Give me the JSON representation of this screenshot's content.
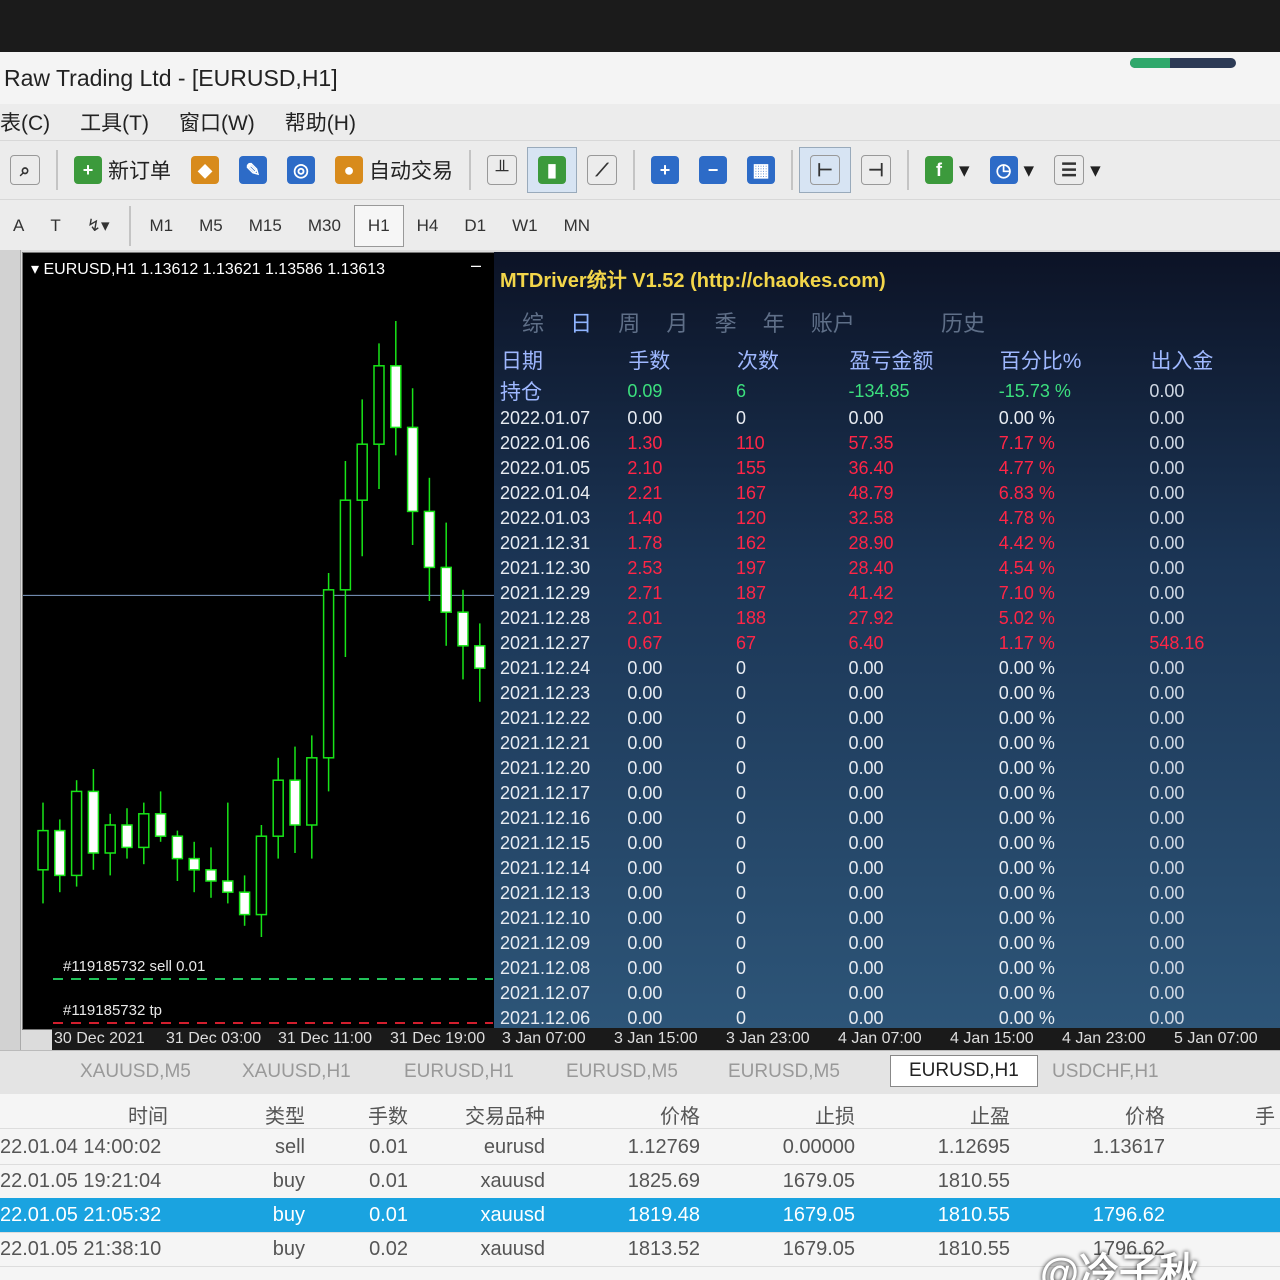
{
  "window": {
    "title": "Raw Trading Ltd - [EURUSD,H1]"
  },
  "menu": [
    "表(C)",
    "工具(T)",
    "窗口(W)",
    "帮助(H)"
  ],
  "toolbar": {
    "new_order": "新订单",
    "auto_trading": "自动交易"
  },
  "timeframes": [
    "M1",
    "M5",
    "M15",
    "M30",
    "H1",
    "H4",
    "D1",
    "W1",
    "MN"
  ],
  "timeframe_active": "H1",
  "drawtools": {
    "text": "A",
    "label": "T"
  },
  "chart": {
    "symbol_line": "EURUSD,H1  1.13612 1.13621 1.13586 1.13613",
    "order_sell": "#119185732 sell 0.01",
    "order_tp": "#119185732 tp",
    "colors": {
      "bull": "#18e418",
      "bg": "#000000"
    },
    "candles": [
      [
        1.1322,
        1.1334,
        1.1316,
        1.1329
      ],
      [
        1.1329,
        1.1331,
        1.1318,
        1.1321
      ],
      [
        1.1321,
        1.1338,
        1.1319,
        1.1336
      ],
      [
        1.1336,
        1.134,
        1.1322,
        1.1325
      ],
      [
        1.1325,
        1.1332,
        1.1321,
        1.133
      ],
      [
        1.133,
        1.1333,
        1.1324,
        1.1326
      ],
      [
        1.1326,
        1.1334,
        1.1323,
        1.1332
      ],
      [
        1.1332,
        1.1336,
        1.1327,
        1.1328
      ],
      [
        1.1328,
        1.1329,
        1.132,
        1.1324
      ],
      [
        1.1324,
        1.1327,
        1.1318,
        1.1322
      ],
      [
        1.1322,
        1.1326,
        1.1317,
        1.132
      ],
      [
        1.132,
        1.1334,
        1.1316,
        1.1318
      ],
      [
        1.1318,
        1.1321,
        1.1312,
        1.1314
      ],
      [
        1.1314,
        1.133,
        1.131,
        1.1328
      ],
      [
        1.1328,
        1.1342,
        1.1324,
        1.1338
      ],
      [
        1.1338,
        1.1344,
        1.1325,
        1.133
      ],
      [
        1.133,
        1.1346,
        1.1324,
        1.1342
      ],
      [
        1.1342,
        1.1375,
        1.1336,
        1.1372
      ],
      [
        1.1372,
        1.1395,
        1.136,
        1.1388
      ],
      [
        1.1388,
        1.1406,
        1.1378,
        1.1398
      ],
      [
        1.1398,
        1.1416,
        1.139,
        1.1412
      ],
      [
        1.1412,
        1.142,
        1.1396,
        1.1401
      ],
      [
        1.1401,
        1.1408,
        1.138,
        1.1386
      ],
      [
        1.1386,
        1.1392,
        1.137,
        1.1376
      ],
      [
        1.1376,
        1.1384,
        1.1362,
        1.1368
      ],
      [
        1.1368,
        1.1372,
        1.1356,
        1.1362
      ],
      [
        1.1362,
        1.1366,
        1.1352,
        1.1358
      ]
    ],
    "ylim": [
      1.13,
      1.1425
    ],
    "hline": 1.1371,
    "xaxis": [
      "30 Dec 2021",
      "31 Dec 03:00",
      "31 Dec 11:00",
      "31 Dec 19:00",
      "3 Jan 07:00",
      "3 Jan 15:00",
      "3 Jan 23:00",
      "4 Jan 07:00",
      "4 Jan 15:00",
      "4 Jan 23:00",
      "5 Jan 07:00"
    ]
  },
  "stats": {
    "header": "MTDriver统计 V1.52 (http://chaokes.com)",
    "tabs": [
      "综",
      "日",
      "周",
      "月",
      "季",
      "年",
      "账户",
      "历史"
    ],
    "tab_active": "日",
    "columns": [
      "日期",
      "手数",
      "次数",
      "盈亏金额",
      "百分比%",
      "出入金"
    ],
    "holding": [
      "持仓",
      "0.09",
      "6",
      "-134.85",
      "-15.73 %",
      "0.00"
    ],
    "rows": [
      [
        "2022.01.07",
        "0.00",
        "0",
        "0.00",
        "0.00 %",
        "0.00"
      ],
      [
        "2022.01.06",
        "1.30",
        "110",
        "57.35",
        "7.17 %",
        "0.00"
      ],
      [
        "2022.01.05",
        "2.10",
        "155",
        "36.40",
        "4.77 %",
        "0.00"
      ],
      [
        "2022.01.04",
        "2.21",
        "167",
        "48.79",
        "6.83 %",
        "0.00"
      ],
      [
        "2022.01.03",
        "1.40",
        "120",
        "32.58",
        "4.78 %",
        "0.00"
      ],
      [
        "2021.12.31",
        "1.78",
        "162",
        "28.90",
        "4.42 %",
        "0.00"
      ],
      [
        "2021.12.30",
        "2.53",
        "197",
        "28.40",
        "4.54 %",
        "0.00"
      ],
      [
        "2021.12.29",
        "2.71",
        "187",
        "41.42",
        "7.10 %",
        "0.00"
      ],
      [
        "2021.12.28",
        "2.01",
        "188",
        "27.92",
        "5.02 %",
        "0.00"
      ],
      [
        "2021.12.27",
        "0.67",
        "67",
        "6.40",
        "1.17 %",
        "548.16"
      ],
      [
        "2021.12.24",
        "0.00",
        "0",
        "0.00",
        "0.00 %",
        "0.00"
      ],
      [
        "2021.12.23",
        "0.00",
        "0",
        "0.00",
        "0.00 %",
        "0.00"
      ],
      [
        "2021.12.22",
        "0.00",
        "0",
        "0.00",
        "0.00 %",
        "0.00"
      ],
      [
        "2021.12.21",
        "0.00",
        "0",
        "0.00",
        "0.00 %",
        "0.00"
      ],
      [
        "2021.12.20",
        "0.00",
        "0",
        "0.00",
        "0.00 %",
        "0.00"
      ],
      [
        "2021.12.17",
        "0.00",
        "0",
        "0.00",
        "0.00 %",
        "0.00"
      ],
      [
        "2021.12.16",
        "0.00",
        "0",
        "0.00",
        "0.00 %",
        "0.00"
      ],
      [
        "2021.12.15",
        "0.00",
        "0",
        "0.00",
        "0.00 %",
        "0.00"
      ],
      [
        "2021.12.14",
        "0.00",
        "0",
        "0.00",
        "0.00 %",
        "0.00"
      ],
      [
        "2021.12.13",
        "0.00",
        "0",
        "0.00",
        "0.00 %",
        "0.00"
      ],
      [
        "2021.12.10",
        "0.00",
        "0",
        "0.00",
        "0.00 %",
        "0.00"
      ],
      [
        "2021.12.09",
        "0.00",
        "0",
        "0.00",
        "0.00 %",
        "0.00"
      ],
      [
        "2021.12.08",
        "0.00",
        "0",
        "0.00",
        "0.00 %",
        "0.00"
      ],
      [
        "2021.12.07",
        "0.00",
        "0",
        "0.00",
        "0.00 %",
        "0.00"
      ],
      [
        "2021.12.06",
        "0.00",
        "0",
        "0.00",
        "0.00 %",
        "0.00"
      ]
    ]
  },
  "chart_tabs": [
    "XAUUSD,M5",
    "XAUUSD,H1",
    "EURUSD,H1",
    "EURUSD,M5",
    "EURUSD,M5",
    "EURUSD,H1",
    "USDCHF,H1"
  ],
  "chart_tab_active": 5,
  "orders": {
    "columns": [
      "时间",
      "类型",
      "手数",
      "交易品种",
      "价格",
      "止损",
      "止盈",
      "价格",
      "手"
    ],
    "rows": [
      [
        "22.01.04 14:00:02",
        "sell",
        "0.01",
        "eurusd",
        "1.12769",
        "0.00000",
        "1.12695",
        "1.13617"
      ],
      [
        "22.01.05 19:21:04",
        "buy",
        "0.01",
        "xauusd",
        "1825.69",
        "1679.05",
        "1810.55",
        ""
      ],
      [
        "22.01.05 21:05:32",
        "buy",
        "0.01",
        "xauusd",
        "1819.48",
        "1679.05",
        "1810.55",
        "1796.62"
      ],
      [
        "22.01.05 21:38:10",
        "buy",
        "0.02",
        "xauusd",
        "1813.52",
        "1679.05",
        "1810.55",
        "1796.62"
      ]
    ],
    "selected_row": 2
  },
  "watermark": "@冷子秋"
}
